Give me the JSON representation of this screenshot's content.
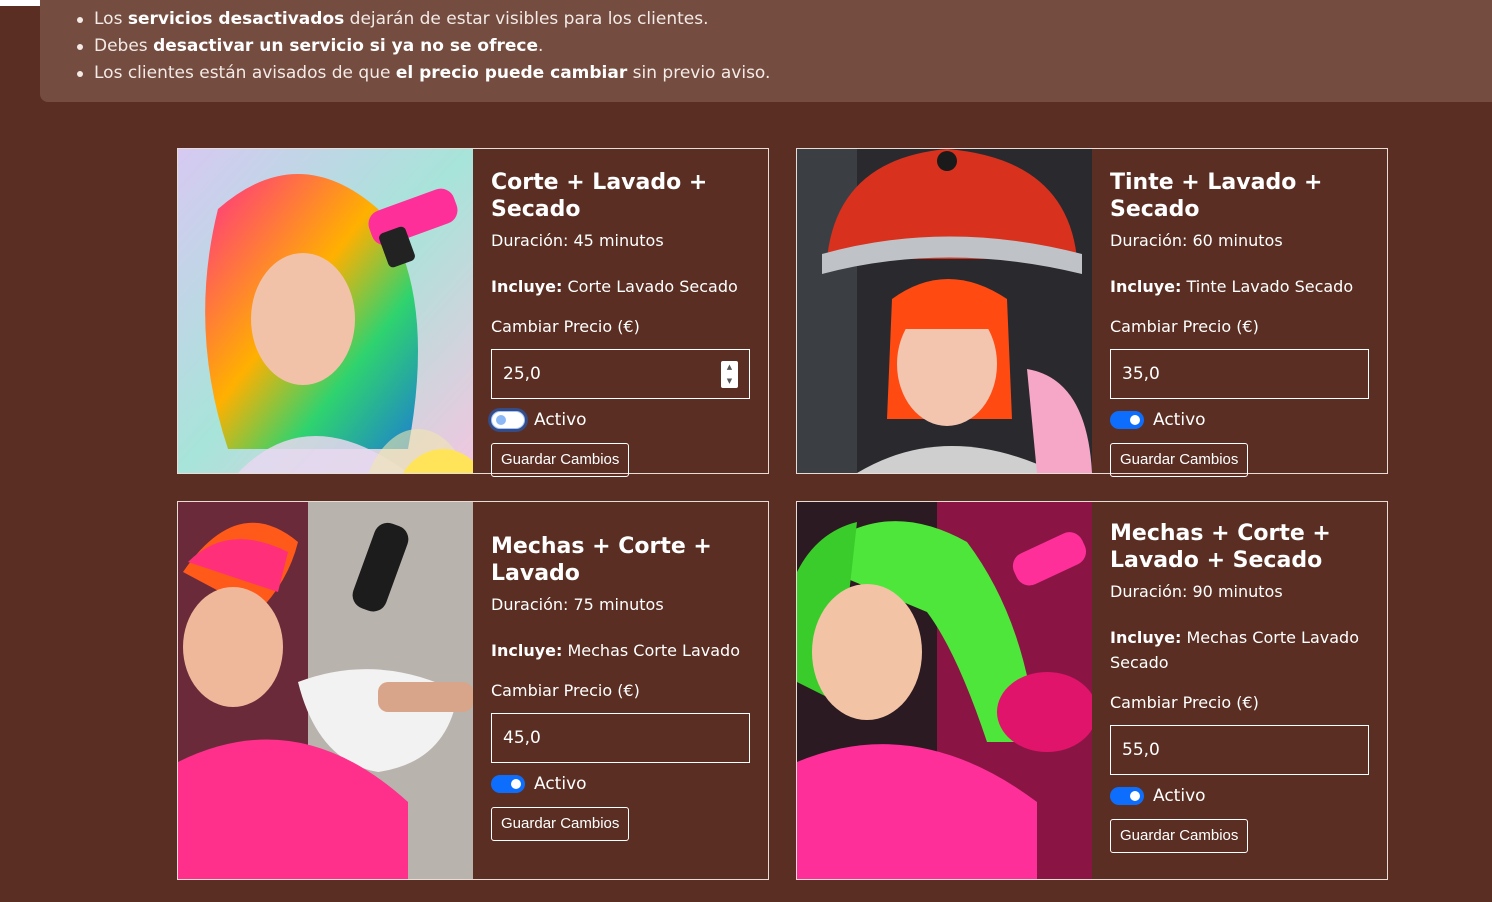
{
  "notice": {
    "items": [
      {
        "pre": "Los ",
        "bold": "servicios desactivados",
        "post": " dejarán de estar visibles para los clientes."
      },
      {
        "pre": "Debes ",
        "bold": "desactivar un servicio si ya no se ofrece",
        "post": "."
      },
      {
        "pre": "Los clientes están avisados de que ",
        "bold": "el precio puede cambiar",
        "post": " sin previo aviso."
      }
    ]
  },
  "services": [
    {
      "title": "Corte + Lavado + Secado",
      "duration": "Duración: 45 minutos",
      "includes_label": "Incluye:",
      "includes": "Corte Lavado Secado",
      "price_label": "Cambiar Precio (€)",
      "price": "25,0",
      "active": false,
      "active_label": "Activo",
      "save_label": "Guardar Cambios",
      "image": "woman-rainbow-hair-blowdryer"
    },
    {
      "title": "Tinte + Lavado + Secado",
      "duration": "Duración: 60 minutos",
      "includes_label": "Incluye:",
      "includes": "Tinte Lavado Secado",
      "price_label": "Cambiar Precio (€)",
      "price": "35,0",
      "active": true,
      "active_label": "Activo",
      "save_label": "Guardar Cambios",
      "image": "woman-orange-hair-under-hood-dryer"
    },
    {
      "title": "Mechas + Corte + Lavado",
      "duration": "Duración: 75 minutos",
      "includes_label": "Incluye:",
      "includes": "Mechas Corte Lavado",
      "price_label": "Cambiar Precio (€)",
      "price": "45,0",
      "active": true,
      "active_label": "Activo",
      "save_label": "Guardar Cambios",
      "image": "woman-mohawk-hair-wash"
    },
    {
      "title": "Mechas + Corte + Lavado + Secado",
      "duration": "Duración: 90 minutos",
      "includes_label": "Incluye:",
      "includes": "Mechas Corte Lavado Secado",
      "price_label": "Cambiar Precio (€)",
      "price": "55,0",
      "active": true,
      "active_label": "Activo",
      "save_label": "Guardar Cambios",
      "image": "woman-green-hair-blowdryer"
    }
  ],
  "colors": {
    "background": "#5a2e22",
    "notice": "#744c40",
    "accent": "#0d6efd"
  }
}
